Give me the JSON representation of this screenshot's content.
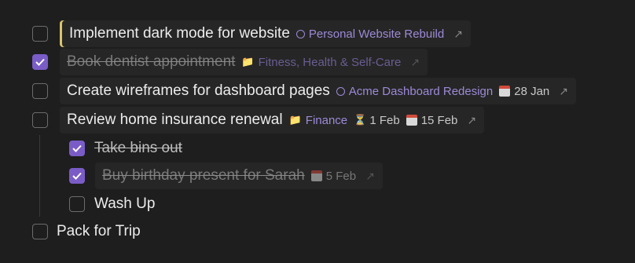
{
  "tasks": [
    {
      "title": "Implement dark mode for website",
      "project": "Personal Website Rebuild",
      "arrow": "↗"
    },
    {
      "title": "Book dentist appointment",
      "project": "Fitness, Health & Self-Care",
      "arrow": "↗"
    },
    {
      "title": "Create wireframes for dashboard pages",
      "project": "Acme Dashboard Redesign",
      "date": "28 Jan",
      "arrow": "↗"
    },
    {
      "title": "Review home insurance renewal",
      "project": "Finance",
      "start": "1 Feb",
      "date": "15 Feb",
      "arrow": "↗"
    },
    {
      "title": "Take bins out"
    },
    {
      "title": "Buy birthday present for Sarah",
      "date": "5 Feb",
      "arrow": "↗"
    },
    {
      "title": "Wash Up"
    },
    {
      "title": "Pack for Trip"
    }
  ],
  "colors": {
    "accent": "#7a5cc6",
    "project": "#9d8ad8",
    "active_bar": "#d9c46b",
    "background": "#1e1e1e"
  }
}
